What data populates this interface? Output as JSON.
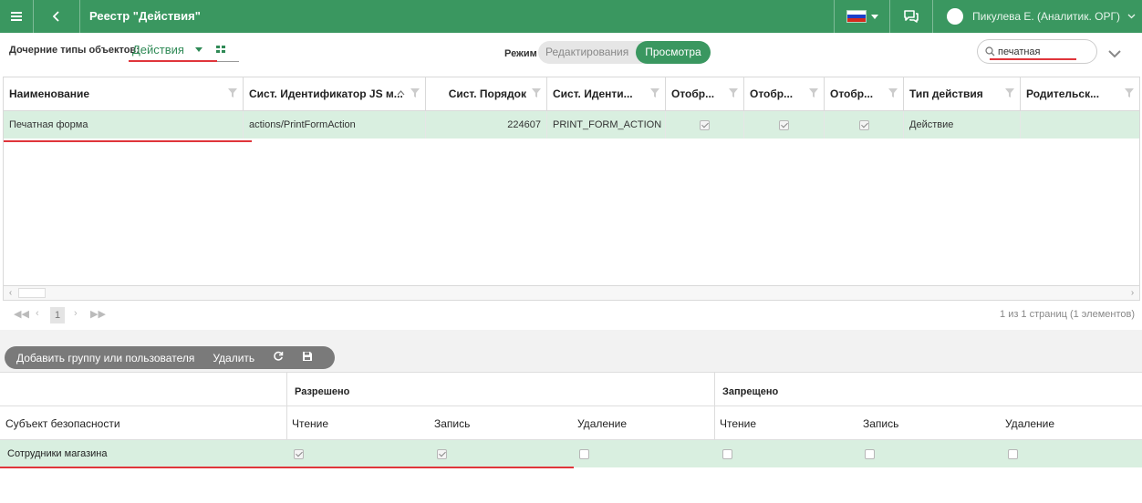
{
  "topbar": {
    "menu_icon": "hamburger-icon",
    "back_icon": "chevron-left-icon",
    "title": "Реестр \"Действия\"",
    "language_flag": "russia-flag-icon",
    "chat_icon": "chat-icon",
    "user": "Пикулева Е. (Аналитик. ОРГ)",
    "bar_color": "#3a9760"
  },
  "filter": {
    "child_types_label": "Дочерние типы объектов:",
    "child_types_value": "Действия",
    "mode_label": "Режим",
    "mode_edit": "Редактирования",
    "mode_view": "Просмотра",
    "mode_active": "Просмотра",
    "search_value": "печатная",
    "search_placeholder": "Поиск"
  },
  "grid": {
    "columns": [
      "Наименование",
      "Сист. Идентификатор JS м...",
      "Сист. Порядок",
      "Сист. Иденти...",
      "Отобр...",
      "Отобр...",
      "Отобр...",
      "Тип действия",
      "Родительск..."
    ],
    "rows": [
      {
        "name": "Печатная форма",
        "js_id": "actions/PrintFormAction",
        "order": "224607",
        "sys_id": "PRINT_FORM_ACTION",
        "show1": true,
        "show2": true,
        "show3": true,
        "action_type": "Действие",
        "parent": ""
      }
    ]
  },
  "pager": {
    "current_page": "1",
    "info": "1 из 1 страниц (1 элементов)"
  },
  "actions": {
    "add_group": "Добавить группу или пользователя",
    "delete": "Удалить",
    "refresh_icon": "refresh-icon",
    "save_icon": "save-icon"
  },
  "permissions": {
    "allowed_header": "Разрешено",
    "denied_header": "Запрещено",
    "subject_header": "Субъект безопасности",
    "read": "Чтение",
    "write": "Запись",
    "delete": "Удаление",
    "rows": [
      {
        "subject": "Сотрудники магазина",
        "allowed_read": true,
        "allowed_write": true,
        "allowed_delete": false,
        "denied_read": false,
        "denied_write": false,
        "denied_delete": false
      }
    ]
  },
  "colors": {
    "accent": "#3a9760",
    "selected_row": "#d9efe0",
    "annotation_underline": "#e0353b"
  }
}
